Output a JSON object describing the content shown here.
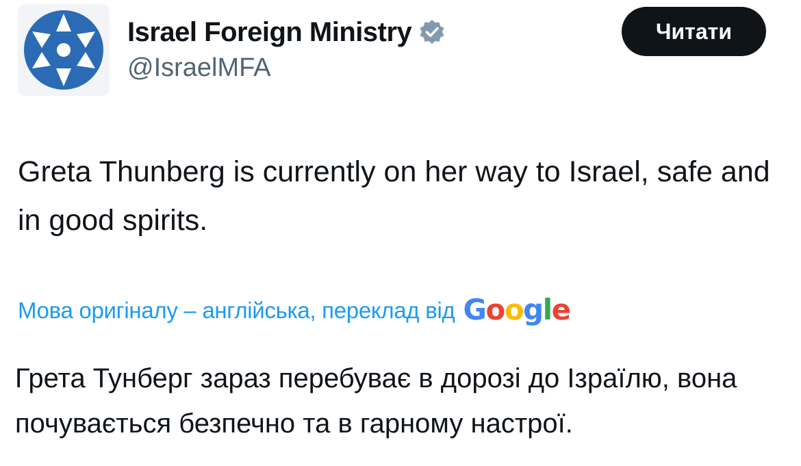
{
  "tweet": {
    "author": {
      "display_name": "Israel Foreign Ministry",
      "handle": "@IsraelMFA",
      "verified": true,
      "avatar_icon": "israel-mfa-star-logo",
      "verified_icon": "verified-badge-icon"
    },
    "follow_button": {
      "label": "Читати"
    },
    "text": "Greta Thunberg is currently on her way to Israel, safe and in good spirits.",
    "translation": {
      "note": "Мова оригіналу – англійська, переклад від",
      "provider": "Google",
      "text": "Грета Тунберг зараз перебуває в дорозі до Ізраїлю, вона почувається безпечно та в гарному настрої."
    }
  },
  "colors": {
    "text_primary": "#0f1419",
    "text_secondary": "#536471",
    "link_blue": "#1d9bf0",
    "button_bg": "#0f1419",
    "verified_gray": "#829aab",
    "avatar_blue": "#2b6bb5"
  }
}
